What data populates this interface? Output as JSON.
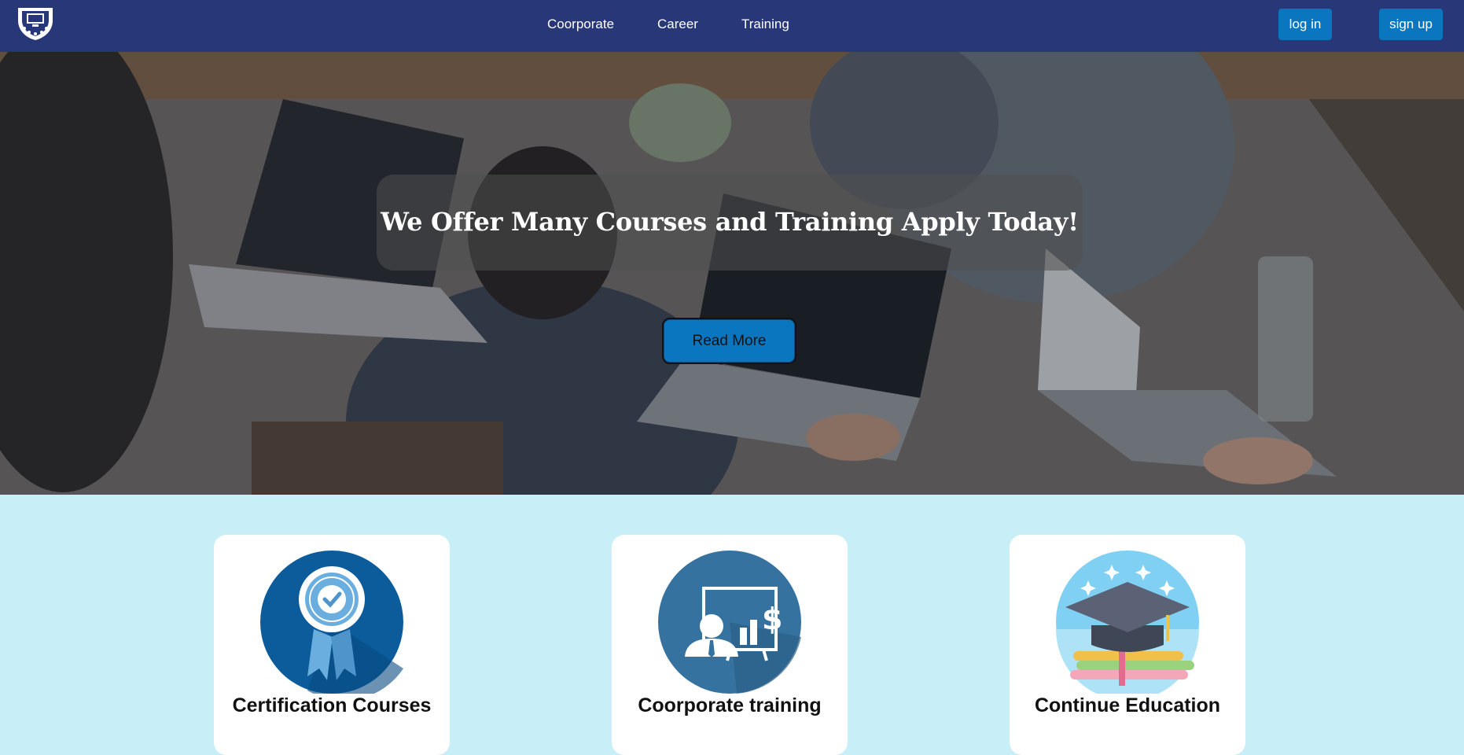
{
  "nav": {
    "links": [
      "Coorporate",
      "Career",
      "Training"
    ],
    "login_label": "log in",
    "signup_label": "sign up",
    "bg_color": "#283777",
    "button_color": "#0a76c0"
  },
  "hero": {
    "headline": "We Offer Many Courses and Training Apply Today!",
    "cta_label": "Read More"
  },
  "cards": [
    {
      "title": "Certification Courses",
      "icon": "award-ribbon-icon"
    },
    {
      "title": "Coorporate training",
      "icon": "presentation-icon"
    },
    {
      "title": "Continue Education",
      "icon": "graduation-cap-icon"
    }
  ],
  "colors": {
    "page_bg": "#c8eff7",
    "card_bg": "#ffffff"
  }
}
